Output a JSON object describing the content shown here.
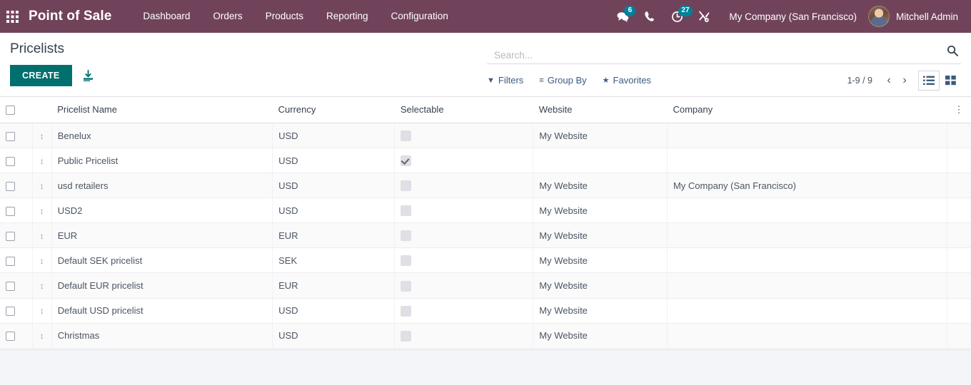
{
  "navbar": {
    "apps_icon": "apps-grid-icon",
    "brand": "Point of Sale",
    "menu": [
      {
        "label": "Dashboard"
      },
      {
        "label": "Orders"
      },
      {
        "label": "Products"
      },
      {
        "label": "Reporting"
      },
      {
        "label": "Configuration"
      }
    ],
    "sys_icons": [
      {
        "name": "messages-icon",
        "glyph": "💬",
        "badge": "6"
      },
      {
        "name": "phone-icon",
        "glyph": "✆",
        "badge": ""
      },
      {
        "name": "activities-clock-icon",
        "glyph": "◴",
        "badge": "27"
      },
      {
        "name": "tools-icon",
        "glyph": "⚒",
        "badge": ""
      }
    ],
    "company": "My Company (San Francisco)",
    "username": "Mitchell Admin",
    "bg_color": "#71435b",
    "badge_color": "#00809b"
  },
  "control_panel": {
    "title": "Pricelists",
    "create_label": "CREATE",
    "create_color": "#00706e",
    "import_icon": "import-download-icon",
    "search": {
      "placeholder": "Search...",
      "value": "",
      "icon": "search-icon"
    },
    "filters": [
      {
        "name": "filters-button",
        "icon": "funnel-icon",
        "glyph": "▼",
        "label": "Filters"
      },
      {
        "name": "group-by-button",
        "icon": "hamburger-icon",
        "glyph": "≡",
        "label": "Group By"
      },
      {
        "name": "favorites-button",
        "icon": "star-icon",
        "glyph": "★",
        "label": "Favorites"
      }
    ],
    "pager": {
      "range": "1-9 / 9",
      "prev": "‹",
      "next": "›"
    },
    "views": [
      {
        "name": "list-view-button",
        "icon": "list-view-icon",
        "active": true
      },
      {
        "name": "kanban-view-button",
        "icon": "kanban-view-icon",
        "active": false
      }
    ]
  },
  "table": {
    "columns": [
      {
        "key": "name",
        "label": "Pricelist Name"
      },
      {
        "key": "currency",
        "label": "Currency"
      },
      {
        "key": "selectable",
        "label": "Selectable"
      },
      {
        "key": "website",
        "label": "Website"
      },
      {
        "key": "company",
        "label": "Company"
      }
    ],
    "optional_columns_icon": "vertical-dots-icon",
    "select_all_checked": false,
    "rows": [
      {
        "name": "Benelux",
        "currency": "USD",
        "selectable": false,
        "website": "My Website",
        "company": ""
      },
      {
        "name": "Public Pricelist",
        "currency": "USD",
        "selectable": true,
        "website": "",
        "company": ""
      },
      {
        "name": "usd retailers",
        "currency": "USD",
        "selectable": false,
        "website": "My Website",
        "company": "My Company (San Francisco)"
      },
      {
        "name": "USD2",
        "currency": "USD",
        "selectable": false,
        "website": "My Website",
        "company": ""
      },
      {
        "name": "EUR",
        "currency": "EUR",
        "selectable": false,
        "website": "My Website",
        "company": ""
      },
      {
        "name": "Default SEK pricelist",
        "currency": "SEK",
        "selectable": false,
        "website": "My Website",
        "company": ""
      },
      {
        "name": "Default EUR pricelist",
        "currency": "EUR",
        "selectable": false,
        "website": "My Website",
        "company": ""
      },
      {
        "name": "Default USD pricelist",
        "currency": "USD",
        "selectable": false,
        "website": "My Website",
        "company": ""
      },
      {
        "name": "Christmas",
        "currency": "USD",
        "selectable": false,
        "website": "My Website",
        "company": ""
      }
    ]
  }
}
